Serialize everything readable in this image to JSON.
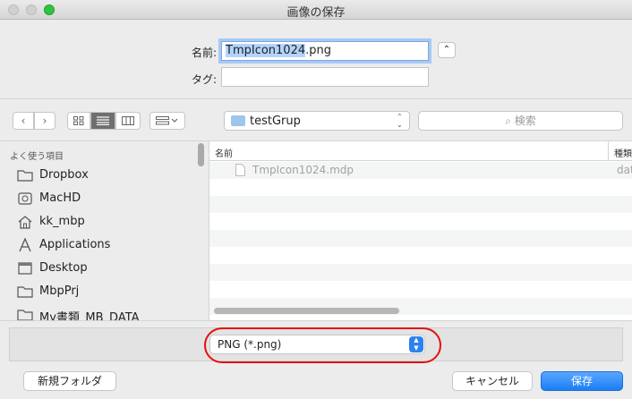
{
  "window": {
    "title": "画像の保存"
  },
  "save": {
    "name_label": "名前:",
    "name_selected": "TmpIcon1024",
    "name_ext": ".png",
    "tag_label": "タグ:",
    "tag_value": "",
    "collapse_glyph": "⌃"
  },
  "toolbar": {
    "back_glyph": "‹",
    "forward_glyph": "›",
    "location": "testGrup",
    "location_chevron": "⌃⌄",
    "search_placeholder": "検索",
    "search_glyph": "⌕"
  },
  "sidebar": {
    "heading": "よく使う項目",
    "items": [
      {
        "label": "Dropbox",
        "icon": "folder-icon"
      },
      {
        "label": "MacHD",
        "icon": "disk-icon"
      },
      {
        "label": "kk_mbp",
        "icon": "home-icon"
      },
      {
        "label": "Applications",
        "icon": "applications-icon"
      },
      {
        "label": "Desktop",
        "icon": "desktop-icon"
      },
      {
        "label": "MbpPrj",
        "icon": "folder-icon"
      },
      {
        "label": "My書類_MB_DATA",
        "icon": "folder-icon"
      }
    ]
  },
  "filelist": {
    "col_name": "名前",
    "col_kind": "種類",
    "rows": [
      {
        "name": "TmpIcon1024.mdp",
        "kind": "dat"
      }
    ]
  },
  "format": {
    "selected": "PNG (*.png)"
  },
  "buttons": {
    "new_folder": "新規フォルダ",
    "cancel": "キャンセル",
    "save": "保存"
  },
  "colors": {
    "accent": "#1b7ef4",
    "highlight_oval": "#e31010"
  }
}
